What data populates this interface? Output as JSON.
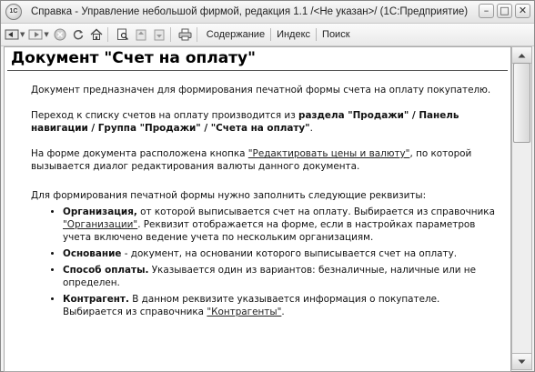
{
  "window": {
    "app_icon_text": "1С",
    "title": "Справка - Управление небольшой фирмой, редакция 1.1 /<Не указан>/ (1С:Предприятие)",
    "minimize": "–",
    "maximize": "□",
    "close": "✕"
  },
  "toolbar": {
    "contents_label": "Содержание",
    "index_label": "Индекс",
    "search_label": "Поиск"
  },
  "document": {
    "title": "Документ \"Счет на оплату\"",
    "p1": "Документ предназначен для формирования печатной формы счета на оплату покупателю.",
    "p2_text": "Переход к списку счетов на оплату производится из ",
    "p2_bold": "раздела \"Продажи\" / Панель навигации / Группа \"Продажи\" / \"Счета на оплату\"",
    "p2_end": ".",
    "p3_text": "На форме документа расположена кнопка ",
    "p3_link": "\"Редактировать цены и валюту\"",
    "p3_end": ", по которой вызывается диалог редактирования валюты данного документа.",
    "p4": "Для формирования печатной формы нужно заполнить следующие реквизиты:",
    "items": [
      {
        "term": "Организация,",
        "text": " от которой выписывается счет на оплату. Выбирается из справочника ",
        "link": "\"Организации\"",
        "text2": ". Реквизит отображается на форме, если в настройках параметров учета включено ведение учета по нескольким организациям."
      },
      {
        "term": "Основание",
        "text": " - документ, на основании которого выписывается счет на оплату."
      },
      {
        "term": "Способ оплаты.",
        "text": " Указывается один из вариантов: безналичные, наличные или не определен."
      },
      {
        "term": "Контрагент.",
        "text": " В данном реквизите указывается информация о покупателе. Выбирается из справочника ",
        "link": "\"Контрагенты\"",
        "text2": "."
      }
    ]
  }
}
